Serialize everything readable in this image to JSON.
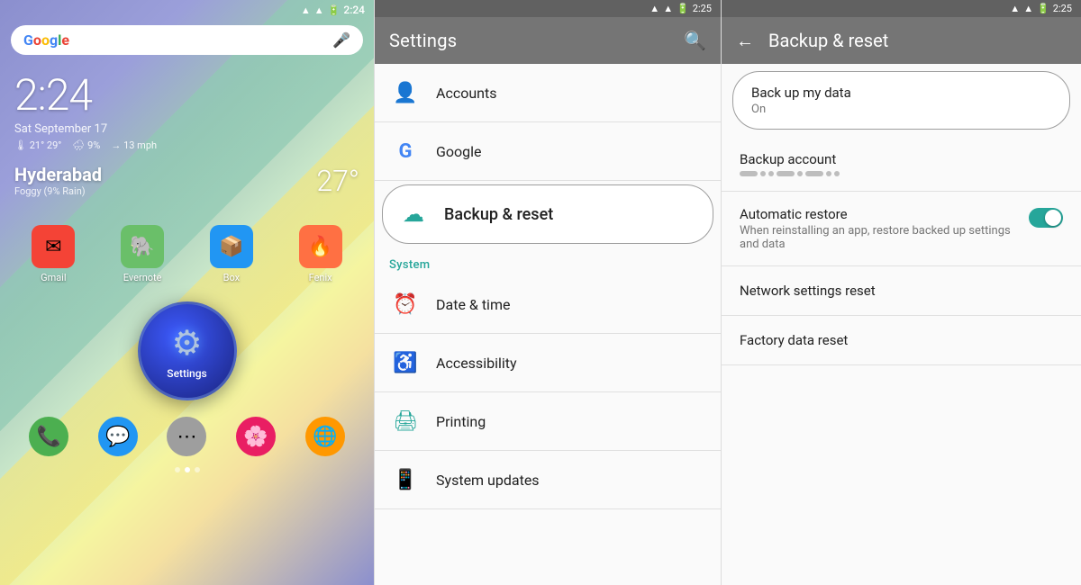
{
  "home": {
    "status_time": "2:24",
    "time_large": "2:24",
    "date": "Sat September 17",
    "weather_temp_high": "21°",
    "weather_temp_low": "29°",
    "weather_rain": "9%",
    "weather_wind": "13 mph",
    "city": "Hyderabad",
    "weather_desc": "Foggy (9% Rain)",
    "temp": "27°",
    "search_placeholder": "Google",
    "apps": [
      {
        "name": "Gmail",
        "label": "Gmail",
        "color": "#f44336",
        "icon": "✉"
      },
      {
        "name": "Evernote",
        "label": "Evernote",
        "color": "#6abf69",
        "icon": "🐘"
      },
      {
        "name": "Box",
        "label": "Box",
        "color": "#2196f3",
        "icon": "📦"
      },
      {
        "name": "Fenix",
        "label": "Fenix",
        "color": "#ff7043",
        "icon": "🔥"
      }
    ],
    "dock": [
      {
        "name": "Phone",
        "icon": "📞",
        "color": "#4caf50"
      },
      {
        "name": "Messages",
        "icon": "💬",
        "color": "#2196f3"
      },
      {
        "name": "Apps",
        "icon": "⋯",
        "color": "#9e9e9e"
      },
      {
        "name": "Photos",
        "icon": "📷",
        "color": "#e91e63"
      },
      {
        "name": "Chrome",
        "icon": "🌐",
        "color": "#ff9800"
      }
    ],
    "settings_label": "Settings"
  },
  "settings": {
    "status_time": "2:25",
    "header_title": "Settings",
    "search_icon": "🔍",
    "items": [
      {
        "id": "accounts",
        "label": "Accounts",
        "icon": "👤"
      },
      {
        "id": "google",
        "label": "Google",
        "icon": "G"
      },
      {
        "id": "backup",
        "label": "Backup & reset",
        "icon": "☁",
        "highlighted": true
      }
    ],
    "system_section": "System",
    "system_items": [
      {
        "id": "datetime",
        "label": "Date & time",
        "icon": "⏰"
      },
      {
        "id": "accessibility",
        "label": "Accessibility",
        "icon": "♿"
      },
      {
        "id": "printing",
        "label": "Printing",
        "icon": "🖨"
      },
      {
        "id": "system_updates",
        "label": "System updates",
        "icon": "📱"
      }
    ]
  },
  "backup": {
    "status_time": "2:25",
    "header_title": "Backup & reset",
    "back_icon": "←",
    "backup_my_data_title": "Back up my data",
    "backup_my_data_value": "On",
    "backup_account_title": "Backup account",
    "automatic_restore_title": "Automatic restore",
    "automatic_restore_desc": "When reinstalling an app, restore backed up settings and data",
    "network_reset_title": "Network settings reset",
    "factory_reset_title": "Factory data reset",
    "toggle_on": true
  }
}
